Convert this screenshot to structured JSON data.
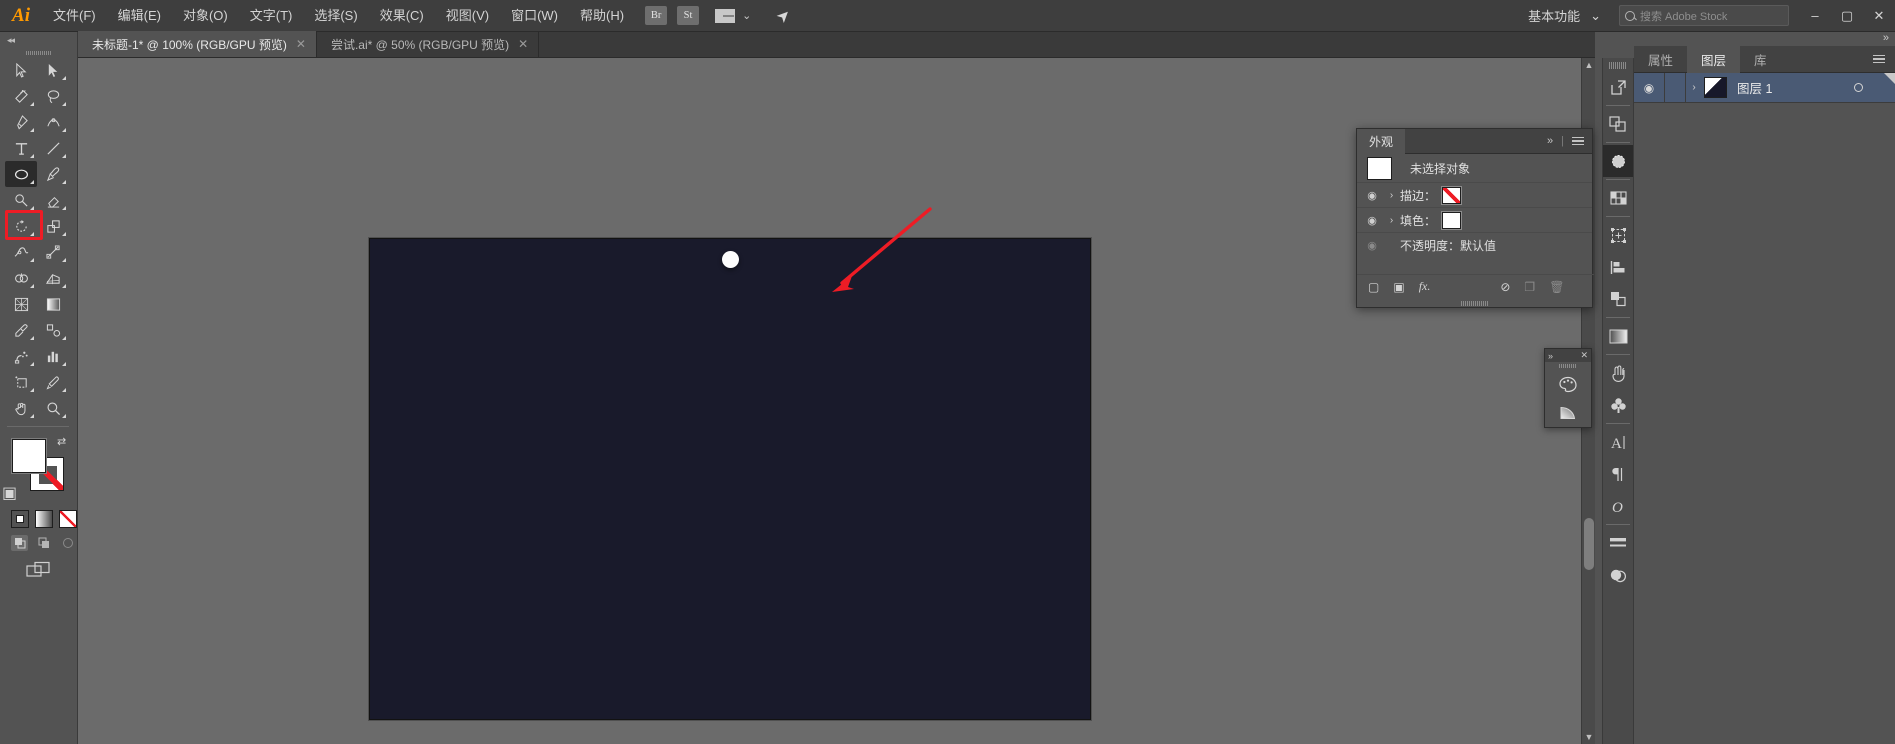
{
  "app": {
    "name": "Adobe Illustrator",
    "logo": "Ai"
  },
  "menubar": {
    "items": [
      {
        "label": "文件(F)",
        "name": "menu-file"
      },
      {
        "label": "编辑(E)",
        "name": "menu-edit"
      },
      {
        "label": "对象(O)",
        "name": "menu-object"
      },
      {
        "label": "文字(T)",
        "name": "menu-type"
      },
      {
        "label": "选择(S)",
        "name": "menu-select"
      },
      {
        "label": "效果(C)",
        "name": "menu-effect"
      },
      {
        "label": "视图(V)",
        "name": "menu-view"
      },
      {
        "label": "窗口(W)",
        "name": "menu-window"
      },
      {
        "label": "帮助(H)",
        "name": "menu-help"
      }
    ],
    "bridge_label": "Br",
    "stock_label": "St",
    "workspace": "基本功能",
    "search_placeholder": "搜索 Adobe Stock",
    "minimize": "–",
    "maximize": "▢",
    "close": "✕"
  },
  "tabs": [
    {
      "title": "未标题-1* @ 100% (RGB/GPU 预览)",
      "active": true,
      "close": "✕"
    },
    {
      "title": "尝试.ai* @ 50% (RGB/GPU 预览)",
      "active": false,
      "close": "✕"
    }
  ],
  "toolbar": {
    "collapse": "◂◂",
    "tools": [
      {
        "name": "selection-tool",
        "row": 0
      },
      {
        "name": "direct-selection-tool",
        "row": 0
      },
      {
        "name": "magic-wand-tool",
        "row": 1
      },
      {
        "name": "lasso-tool",
        "row": 1
      },
      {
        "name": "pen-tool",
        "row": 2
      },
      {
        "name": "curvature-tool",
        "row": 2
      },
      {
        "name": "type-tool",
        "row": 3
      },
      {
        "name": "line-segment-tool",
        "row": 3
      },
      {
        "name": "ellipse-tool",
        "row": 4,
        "selected": true,
        "annotated": true
      },
      {
        "name": "paintbrush-tool",
        "row": 4
      },
      {
        "name": "shaper-tool",
        "row": 5
      },
      {
        "name": "eraser-tool",
        "row": 5
      },
      {
        "name": "rotate-tool",
        "row": 6
      },
      {
        "name": "scale-tool",
        "row": 6
      },
      {
        "name": "width-tool",
        "row": 7
      },
      {
        "name": "free-transform-tool",
        "row": 7
      },
      {
        "name": "shape-builder-tool",
        "row": 8
      },
      {
        "name": "perspective-grid-tool",
        "row": 8
      },
      {
        "name": "mesh-tool",
        "row": 9
      },
      {
        "name": "gradient-tool",
        "row": 9
      },
      {
        "name": "eyedropper-tool",
        "row": 10
      },
      {
        "name": "blend-tool",
        "row": 10
      },
      {
        "name": "symbol-sprayer-tool",
        "row": 11
      },
      {
        "name": "column-graph-tool",
        "row": 11
      },
      {
        "name": "artboard-tool",
        "row": 12
      },
      {
        "name": "slice-tool",
        "row": 12
      },
      {
        "name": "hand-tool",
        "row": 13
      },
      {
        "name": "zoom-tool",
        "row": 13
      }
    ],
    "fill_color": "#ffffff",
    "stroke_color": "#ffffff",
    "swap_icon": "⇄",
    "default_icon": "▣",
    "fill_modes": [
      "color-mode",
      "gradient-mode",
      "none-mode"
    ],
    "draw_modes": [
      "draw-normal",
      "draw-behind",
      "draw-inside"
    ],
    "screen_mode": "change-screen-mode"
  },
  "canvas": {
    "background_color": "#6b6b6b",
    "artboard_color": "#191a2b",
    "shape": {
      "type": "circle",
      "fill": "#fcfcfc"
    },
    "annotation": {
      "type": "arrow",
      "color": "#ee1c25"
    },
    "scroll_up": "▲",
    "scroll_down": "▼"
  },
  "appearance_panel": {
    "title": "外观",
    "collapse_icon": "»",
    "menu_icon": "menu",
    "selection_label": "未选择对象",
    "rows": [
      {
        "label": "描边：",
        "swatch": "none",
        "eye": true,
        "expandable": true
      },
      {
        "label": "填色：",
        "swatch": "white",
        "eye": true,
        "expandable": true
      },
      {
        "label": "不透明度：默认值",
        "swatch": null,
        "eye": false,
        "expandable": false
      }
    ],
    "footer": [
      {
        "name": "add-new-stroke-button",
        "glyph": "▢"
      },
      {
        "name": "add-new-fill-button",
        "glyph": "▣"
      },
      {
        "name": "add-new-effect-button",
        "glyph": "fx."
      },
      {
        "name": "clear-appearance-button",
        "glyph": "⊘"
      },
      {
        "name": "duplicate-item-button",
        "glyph": "❐"
      },
      {
        "name": "delete-item-button",
        "glyph": "🗑"
      }
    ]
  },
  "mini_panel": {
    "collapse_icon": "»",
    "close_icon": "✕",
    "buttons": [
      {
        "name": "swatches-panel-icon"
      },
      {
        "name": "gradient-panel-icon"
      }
    ]
  },
  "icon_rail": {
    "items": [
      {
        "name": "expand-panels-icon",
        "group": 0
      },
      {
        "name": "pathfinder-icon",
        "group": 1
      },
      {
        "name": "color-guide-icon",
        "group": 2,
        "selected": true
      },
      {
        "name": "swatches-grid-icon",
        "group": 3
      },
      {
        "name": "transform-icon",
        "group": 4
      },
      {
        "name": "align-icon",
        "group": 4
      },
      {
        "name": "pathfinder-shapes-icon",
        "group": 4
      },
      {
        "name": "gradient-icon",
        "group": 5
      },
      {
        "name": "brushes-icon",
        "group": 6
      },
      {
        "name": "symbols-icon",
        "group": 6
      },
      {
        "name": "character-icon",
        "group": 7
      },
      {
        "name": "paragraph-icon",
        "group": 7
      },
      {
        "name": "opentype-icon",
        "group": 7
      },
      {
        "name": "stroke-icon",
        "group": 8
      },
      {
        "name": "transparency-icon",
        "group": 8
      }
    ]
  },
  "dock": {
    "collapse_icon": "»",
    "tabs": [
      {
        "label": "属性",
        "name": "tab-properties",
        "active": false
      },
      {
        "label": "图层",
        "name": "tab-layers",
        "active": true
      },
      {
        "label": "库",
        "name": "tab-libraries",
        "active": false
      }
    ],
    "menu_icon": "menu",
    "layers": [
      {
        "name": "图层 1",
        "visible": true,
        "selected": true,
        "eye": "◉",
        "expand": "›",
        "target": "○"
      }
    ]
  }
}
